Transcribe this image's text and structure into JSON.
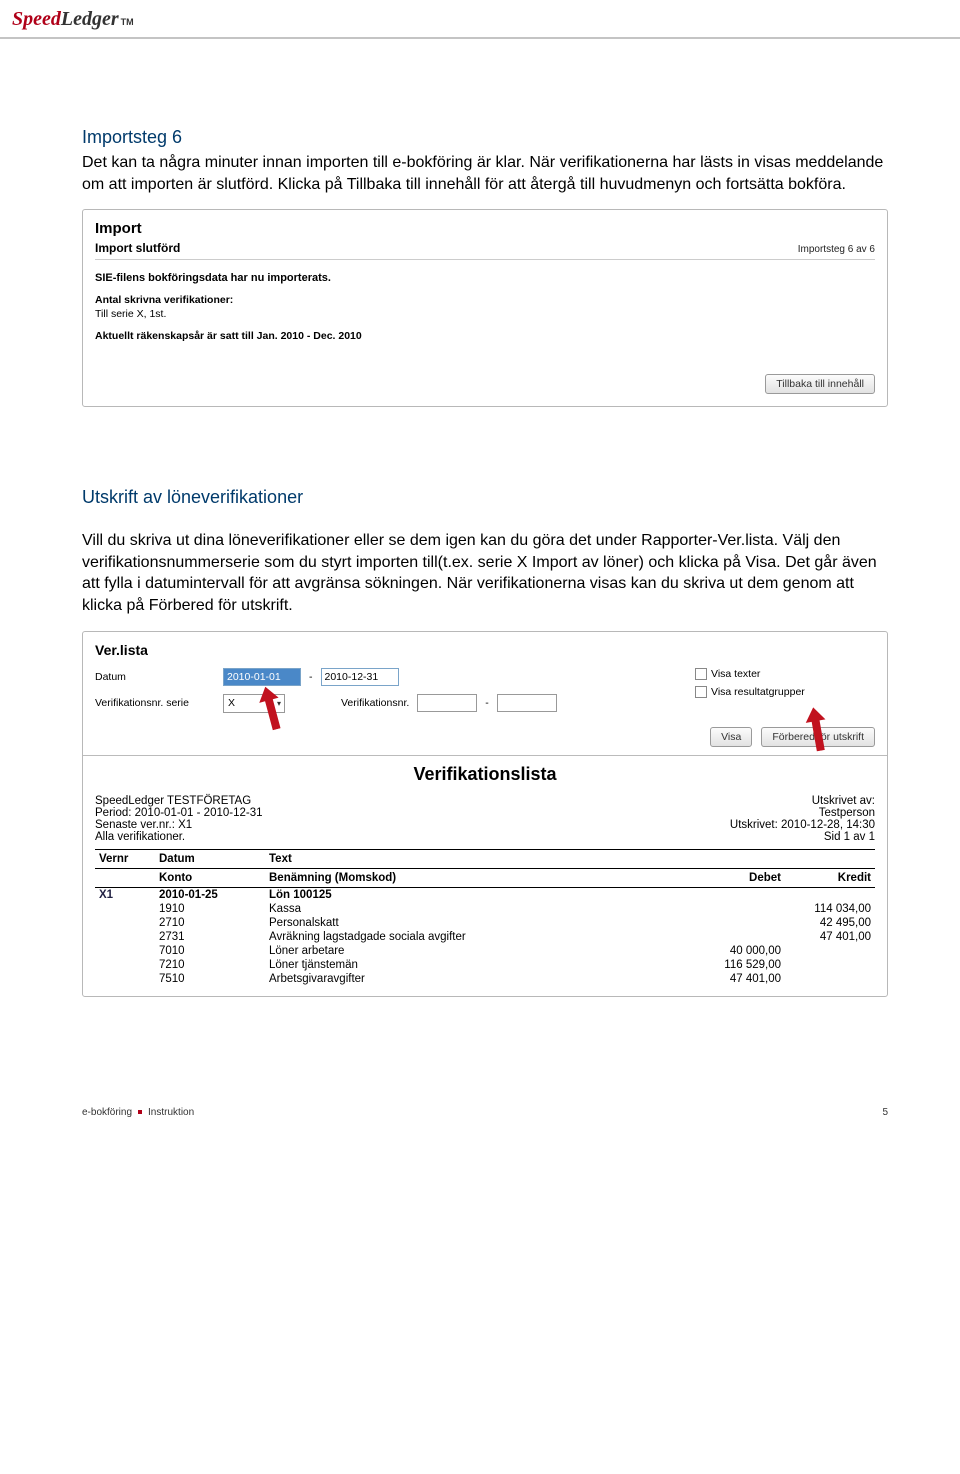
{
  "logo": {
    "speed": "Speed",
    "ledger": "Ledger",
    "tm": "TM"
  },
  "step6": {
    "heading": "Importsteg 6",
    "para": "Det kan ta några minuter innan importen till e-bokföring är klar. När verifikationerna har lästs in visas meddelande om att importen är slutförd. Klicka på Tillbaka till innehåll för att återgå till huvudmenyn och fortsätta bokföra."
  },
  "importPanel": {
    "title": "Import",
    "subtitle": "Import slutförd",
    "step": "Importsteg 6 av 6",
    "line1": "SIE-filens bokföringsdata har nu importerats.",
    "line2_label": "Antal skrivna verifikationer:",
    "line3": "Till serie X, 1st.",
    "line4": "Aktuellt räkenskapsår är satt till Jan. 2010 - Dec. 2010",
    "back_btn": "Tillbaka till innehåll"
  },
  "utskrift": {
    "heading": "Utskrift av löneverifikationer",
    "para": "Vill du skriva ut dina löneverifikationer eller se dem igen kan du göra det under Rapporter-Ver.lista. Välj den verifikationsnummerserie som du styrt importen till(t.ex. serie X Import av löner) och klicka på Visa. Det går även att fylla i datumintervall för att avgränsa sökningen. När verifikationerna visas kan du skriva ut dem genom att klicka på Förbered för utskrift."
  },
  "verPanel": {
    "title": "Ver.lista",
    "labels": {
      "datum": "Datum",
      "dash": "-",
      "verserie": "Verifikationsnr. serie",
      "vernr": "Verifikationsnr.",
      "visa_texter": "Visa texter",
      "visa_result": "Visa resultatgrupper",
      "visa_btn": "Visa",
      "forbered_btn": "Förbered för utskrift"
    },
    "date_from": "2010-01-01",
    "date_to": "2010-12-31",
    "serie_sel": "X"
  },
  "verList": {
    "title": "Verifikationslista",
    "meta_left": {
      "l1": "SpeedLedger TESTFÖRETAG",
      "l2": "Period: 2010-01-01 - 2010-12-31",
      "l3": "Senaste ver.nr.: X1",
      "l4": "Alla verifikationer."
    },
    "meta_right": {
      "l1": "Utskrivet av:",
      "l2": "Testperson",
      "l3": "Utskrivet: 2010-12-28, 14:30",
      "l4": "Sid 1 av 1"
    },
    "head1": {
      "vernr": "Vernr",
      "datum": "Datum",
      "text": "Text"
    },
    "head2": {
      "konto": "Konto",
      "benamn": "Benämning (Momskod)",
      "debet": "Debet",
      "kredit": "Kredit"
    },
    "entry": {
      "vernr": "X1",
      "datum": "2010-01-25",
      "text": "Lön 100125"
    },
    "rows": [
      {
        "konto": "1910",
        "benamn": "Kassa",
        "debet": "",
        "kredit": "114 034,00"
      },
      {
        "konto": "2710",
        "benamn": "Personalskatt",
        "debet": "",
        "kredit": "42 495,00"
      },
      {
        "konto": "2731",
        "benamn": "Avräkning lagstadgade sociala avgifter",
        "debet": "",
        "kredit": "47 401,00"
      },
      {
        "konto": "7010",
        "benamn": "Löner arbetare",
        "debet": "40 000,00",
        "kredit": ""
      },
      {
        "konto": "7210",
        "benamn": "Löner tjänstemän",
        "debet": "116 529,00",
        "kredit": ""
      },
      {
        "konto": "7510",
        "benamn": "Arbetsgivaravgifter",
        "debet": "47 401,00",
        "kredit": ""
      }
    ]
  },
  "footer": {
    "left1": "e-bokföring",
    "left2": "Instruktion",
    "page": "5"
  }
}
